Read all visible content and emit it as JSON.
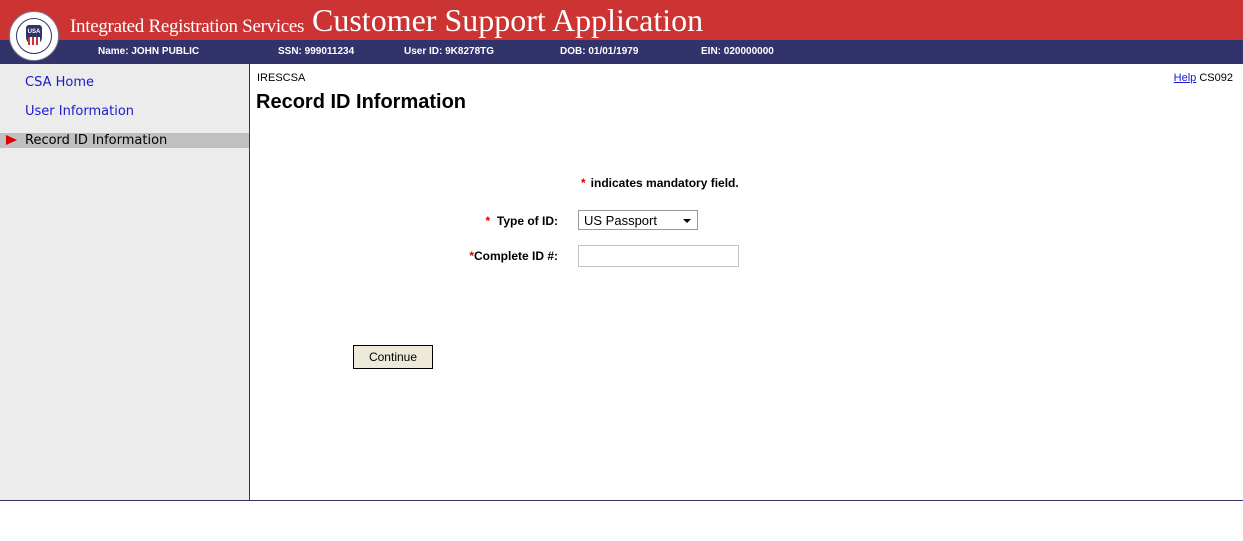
{
  "header": {
    "logo_text": "SOCIAL SECURITY ADMINISTRATION USA",
    "seal_center": "USA",
    "subtitle": "Integrated Registration Services",
    "title": "Customer Support Application",
    "bar_color": "#cc3333",
    "info_bar_color": "#33336b"
  },
  "user_info": {
    "name": "Name: JOHN PUBLIC",
    "ssn": "SSN: 999011234",
    "user_id": "User ID: 9K8278TG",
    "dob": "DOB: 01/01/1979",
    "ein": "EIN: 020000000"
  },
  "sidebar": {
    "items": [
      {
        "label": "CSA Home"
      },
      {
        "label": "User Information"
      },
      {
        "label": "Record ID Information"
      }
    ],
    "active_icon": "right-arrow-icon"
  },
  "main": {
    "breadcrumb": "IRESCSA",
    "help_label": "Help",
    "screen_code": "CS092",
    "page_title": "Record ID Information",
    "mandatory_asterisk": "*",
    "mandatory_note": "indicates mandatory field.",
    "fields": {
      "type_of_id": {
        "label": "Type of ID:",
        "value": "US Passport"
      },
      "complete_id": {
        "label": "Complete ID #:",
        "value": "",
        "placeholder": ""
      }
    },
    "continue_label": "Continue"
  }
}
